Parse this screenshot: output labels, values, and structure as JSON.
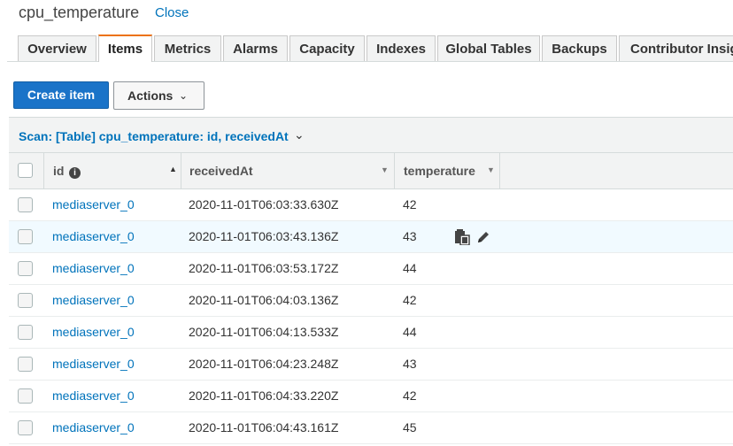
{
  "header": {
    "title": "cpu_temperature",
    "close_label": "Close"
  },
  "tabs": [
    {
      "label": "Overview",
      "active": false
    },
    {
      "label": "Items",
      "active": true
    },
    {
      "label": "Metrics",
      "active": false
    },
    {
      "label": "Alarms",
      "active": false
    },
    {
      "label": "Capacity",
      "active": false
    },
    {
      "label": "Indexes",
      "active": false
    },
    {
      "label": "Global Tables",
      "active": false
    },
    {
      "label": "Backups",
      "active": false
    },
    {
      "label": "Contributor Insights",
      "active": false
    }
  ],
  "toolbar": {
    "create_label": "Create item",
    "actions_label": "Actions"
  },
  "scan": {
    "label": "Scan: [Table] cpu_temperature: id, receivedAt"
  },
  "table": {
    "columns": [
      "id",
      "receivedAt",
      "temperature"
    ],
    "rows": [
      {
        "id": "mediaserver_0",
        "receivedAt": "2020-11-01T06:03:33.630Z",
        "temperature": "42"
      },
      {
        "id": "mediaserver_0",
        "receivedAt": "2020-11-01T06:03:43.136Z",
        "temperature": "43"
      },
      {
        "id": "mediaserver_0",
        "receivedAt": "2020-11-01T06:03:53.172Z",
        "temperature": "44"
      },
      {
        "id": "mediaserver_0",
        "receivedAt": "2020-11-01T06:04:03.136Z",
        "temperature": "42"
      },
      {
        "id": "mediaserver_0",
        "receivedAt": "2020-11-01T06:04:13.533Z",
        "temperature": "44"
      },
      {
        "id": "mediaserver_0",
        "receivedAt": "2020-11-01T06:04:23.248Z",
        "temperature": "43"
      },
      {
        "id": "mediaserver_0",
        "receivedAt": "2020-11-01T06:04:33.220Z",
        "temperature": "42"
      },
      {
        "id": "mediaserver_0",
        "receivedAt": "2020-11-01T06:04:43.161Z",
        "temperature": "45"
      }
    ],
    "hovered_row": 1,
    "row_icons": [
      "copy-icon",
      "edit-pencil-icon"
    ]
  },
  "colors": {
    "accent_tab": "#ec7211",
    "primary_button": "#1a73c8",
    "link": "#0073bb"
  }
}
